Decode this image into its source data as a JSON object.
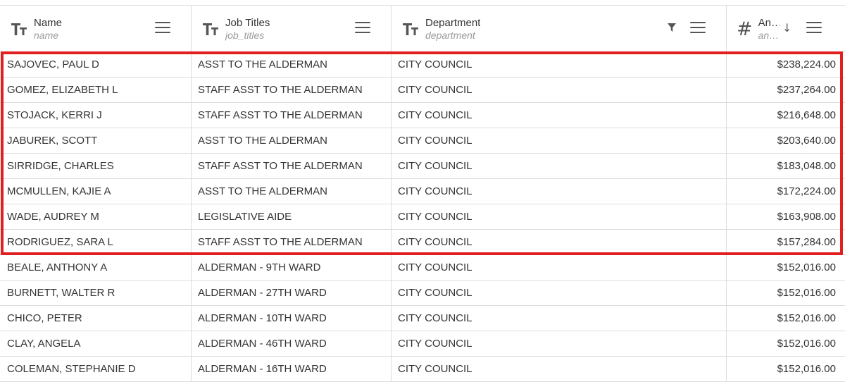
{
  "columns": [
    {
      "title": "Name",
      "field": "name",
      "type_icon": "text-type-icon"
    },
    {
      "title": "Job Titles",
      "field": "job_titles",
      "type_icon": "text-type-icon"
    },
    {
      "title": "Department",
      "field": "department",
      "type_icon": "text-type-icon",
      "has_filter": true
    },
    {
      "title": "An…",
      "field": "an…",
      "type_icon": "number-type-icon",
      "sort": "descending"
    }
  ],
  "rows": [
    {
      "name": "SAJOVEC, PAUL D",
      "job_title": "ASST TO THE ALDERMAN",
      "department": "CITY COUNCIL",
      "amount": "$238,224.00"
    },
    {
      "name": "GOMEZ, ELIZABETH L",
      "job_title": "STAFF ASST TO THE ALDERMAN",
      "department": "CITY COUNCIL",
      "amount": "$237,264.00"
    },
    {
      "name": "STOJACK, KERRI J",
      "job_title": "STAFF ASST TO THE ALDERMAN",
      "department": "CITY COUNCIL",
      "amount": "$216,648.00"
    },
    {
      "name": "JABUREK, SCOTT",
      "job_title": "ASST TO THE ALDERMAN",
      "department": "CITY COUNCIL",
      "amount": "$203,640.00"
    },
    {
      "name": "SIRRIDGE, CHARLES",
      "job_title": "STAFF ASST TO THE ALDERMAN",
      "department": "CITY COUNCIL",
      "amount": "$183,048.00"
    },
    {
      "name": "MCMULLEN, KAJIE A",
      "job_title": "ASST TO THE ALDERMAN",
      "department": "CITY COUNCIL",
      "amount": "$172,224.00"
    },
    {
      "name": "WADE, AUDREY M",
      "job_title": "LEGISLATIVE AIDE",
      "department": "CITY COUNCIL",
      "amount": "$163,908.00"
    },
    {
      "name": "RODRIGUEZ, SARA L",
      "job_title": "STAFF ASST TO THE ALDERMAN",
      "department": "CITY COUNCIL",
      "amount": "$157,284.00"
    },
    {
      "name": "BEALE, ANTHONY A",
      "job_title": "ALDERMAN - 9TH WARD",
      "department": "CITY COUNCIL",
      "amount": "$152,016.00"
    },
    {
      "name": "BURNETT, WALTER R",
      "job_title": "ALDERMAN - 27TH WARD",
      "department": "CITY COUNCIL",
      "amount": "$152,016.00"
    },
    {
      "name": "CHICO, PETER",
      "job_title": "ALDERMAN - 10TH WARD",
      "department": "CITY COUNCIL",
      "amount": "$152,016.00"
    },
    {
      "name": "CLAY, ANGELA",
      "job_title": "ALDERMAN - 46TH WARD",
      "department": "CITY COUNCIL",
      "amount": "$152,016.00"
    },
    {
      "name": "COLEMAN, STEPHANIE D",
      "job_title": "ALDERMAN - 16TH WARD",
      "department": "CITY COUNCIL",
      "amount": "$152,016.00"
    }
  ],
  "highlight": {
    "color": "#e02020",
    "highlighted_row_count": 8
  },
  "colors": {
    "border": "#dcdcdc",
    "text": "#333333",
    "subtext": "#9a9a9a",
    "highlight": "#e02020"
  }
}
